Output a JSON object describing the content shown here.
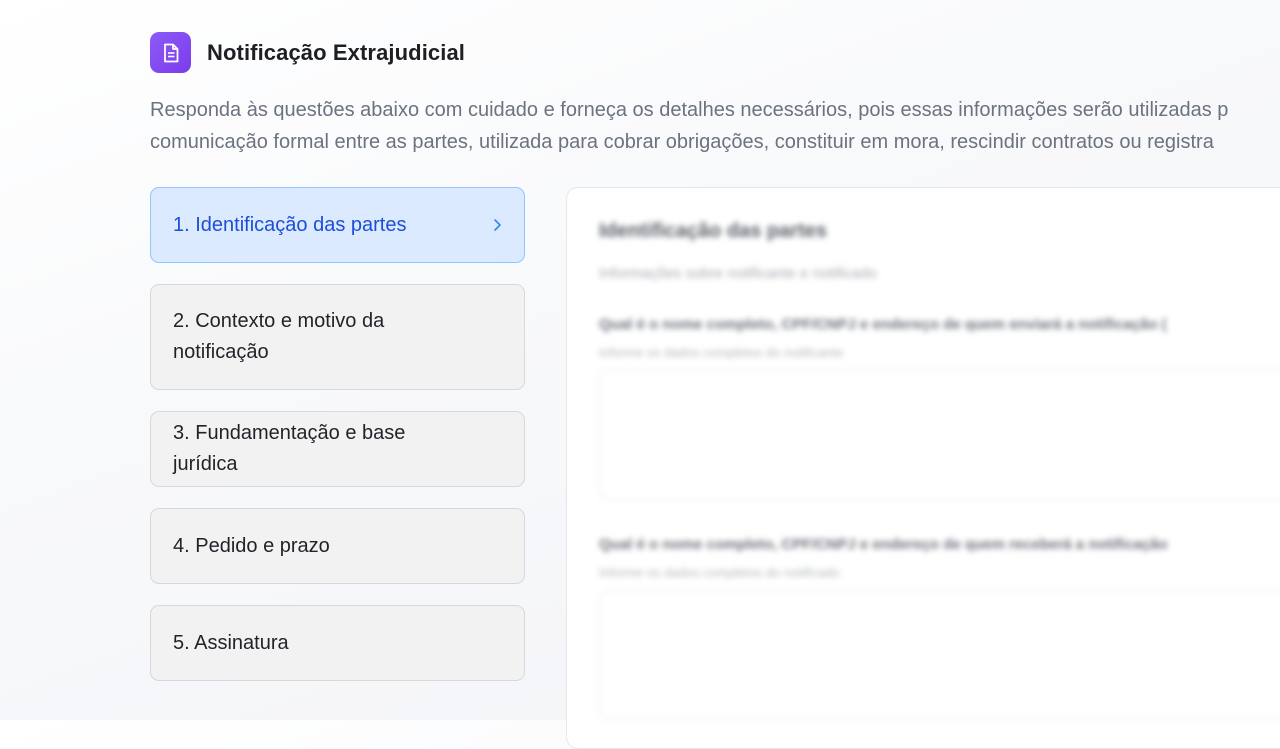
{
  "header": {
    "icon": "document-icon",
    "accent": "#7c3aed",
    "title": "Notificação Extrajudicial"
  },
  "description": {
    "line1": "Responda às questões abaixo com cuidado e forneça os detalhes necessários, pois essas informações serão utilizadas p",
    "line2": "comunicação formal entre as partes, utilizada para cobrar obrigações, constituir em mora, rescindir contratos ou registra"
  },
  "steps": [
    {
      "label": "1. Identificação das partes",
      "active": true
    },
    {
      "label": "2. Contexto e motivo da notificação",
      "active": false
    },
    {
      "label": "3. Fundamentação e base jurídica",
      "active": false
    },
    {
      "label": "4. Pedido e prazo",
      "active": false
    },
    {
      "label": "5. Assinatura",
      "active": false
    }
  ],
  "panel": {
    "title": "Identificação das partes",
    "subtitle": "Informações sobre notificante e notificado",
    "questions": [
      {
        "label": "Qual é o nome completo, CPF/CNPJ e endereço de quem enviará a notificação (",
        "hint": "Informe os dados completos do notificante",
        "value": ""
      },
      {
        "label": "Qual é o nome completo, CPF/CNPJ e endereço de quem receberá a notificação",
        "hint": "Informe os dados completos do notificado",
        "value": ""
      }
    ]
  },
  "colors": {
    "active_bg": "#dbeafe",
    "active_border": "#93c5fd",
    "active_text": "#1d4ed8",
    "step_bg": "#f2f2f3"
  }
}
